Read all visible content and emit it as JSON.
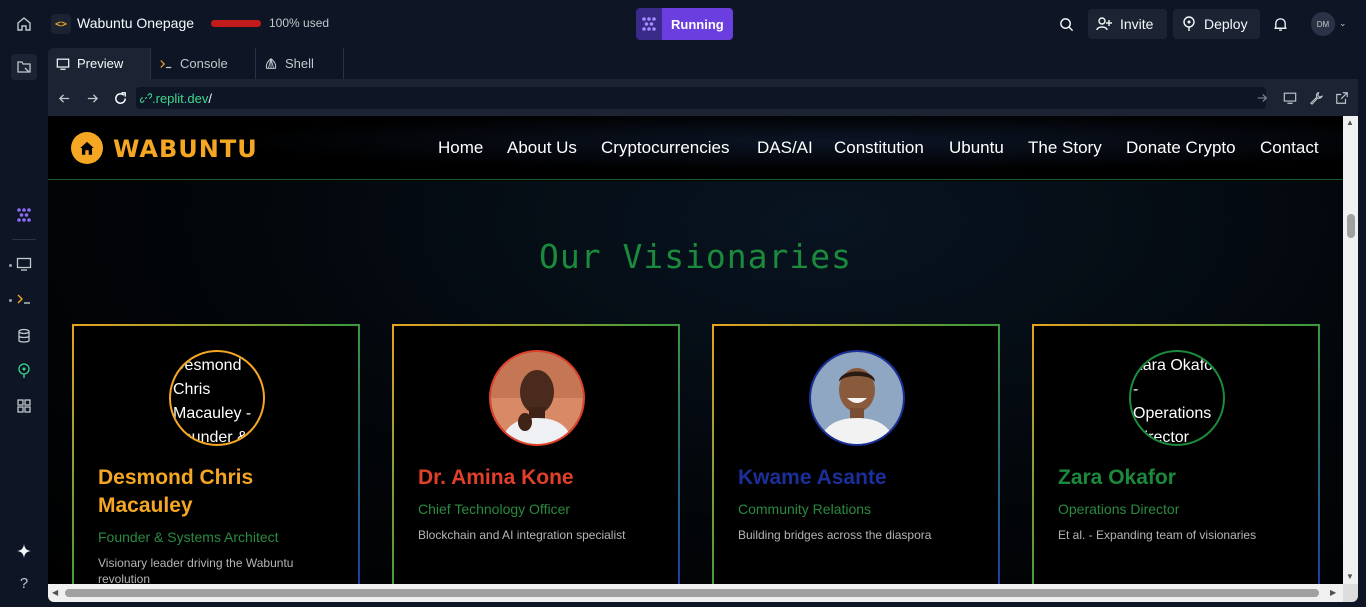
{
  "topbar": {
    "repl_title": "Wabuntu Onepage",
    "usage_text": "100% used",
    "usage_fraction": 1.0,
    "run_label": "Running",
    "invite_label": "Invite",
    "deploy_label": "Deploy",
    "avatar_initials": "DM"
  },
  "tabs": [
    {
      "label": "Preview",
      "icon": "monitor-icon"
    },
    {
      "label": "Console",
      "icon": "terminal-icon"
    },
    {
      "label": "Shell",
      "icon": "shell-icon"
    }
  ],
  "url": {
    "host": ".replit.dev",
    "path": "/"
  },
  "site": {
    "logo_text": "WABUNTU",
    "nav": [
      "Home",
      "About Us",
      "Cryptocurrencies",
      "DAS/AI",
      "Constitution",
      "Ubuntu",
      "The Story",
      "Donate Crypto",
      "Contact"
    ],
    "section_title": "Our Visionaries",
    "members": [
      {
        "name": "Desmond Chris Macauley",
        "role": "Founder & Systems Architect",
        "desc": "Visionary leader driving the Wabuntu revolution",
        "photo_alt": "Desmond Chris Macauley - Founder & Systems Architect",
        "accent": "#f5a623",
        "photo_loaded": false
      },
      {
        "name": "Dr. Amina Kone",
        "role": "Chief Technology Officer",
        "desc": "Blockchain and AI integration specialist",
        "photo_alt": "",
        "accent": "#e0402a",
        "photo_loaded": true
      },
      {
        "name": "Kwame Asante",
        "role": "Community Relations",
        "desc": "Building bridges across the diaspora",
        "photo_alt": "",
        "accent": "#1b2f9a",
        "photo_loaded": true
      },
      {
        "name": "Zara Okafor",
        "role": "Operations Director",
        "desc": "Et al. - Expanding team of visionaries",
        "photo_alt": "Zara Okafor - Operations Director",
        "accent": "#1b8a3c",
        "photo_loaded": false
      }
    ]
  }
}
